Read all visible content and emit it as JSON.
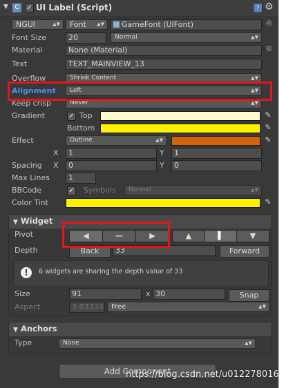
{
  "header": {
    "title": "UI Label (Script)",
    "icons": [
      "foldout-triangle",
      "script-icon",
      "enabled-checkbox",
      "book-icon",
      "gear-icon"
    ]
  },
  "font_row": {
    "type_value": "NGUI",
    "font_value": "Font",
    "font_asset": "GameFont (UIFont)"
  },
  "font_size": {
    "label": "Font Size",
    "value": "20",
    "style": "Normal"
  },
  "material": {
    "label": "Material",
    "value": "None (Material)"
  },
  "text": {
    "label": "Text",
    "value": "TEXT_MAINVIEW_13"
  },
  "overflow": {
    "label": "Overflow",
    "value": "Shrink Content"
  },
  "alignment": {
    "label": "Alignment",
    "value": "Left",
    "label_color": "#4c8cf0"
  },
  "keep_crisp": {
    "label": "Keep crisp",
    "value": "Never"
  },
  "gradient": {
    "label": "Gradient",
    "top_label": "Top",
    "top_color": "#fffdd0",
    "bottom_label": "Bottom",
    "bottom_color": "#fff200"
  },
  "effect": {
    "label": "Effect",
    "value": "Outline",
    "color": "#d26410",
    "x_label": "X",
    "x_value": "1",
    "y_label": "Y",
    "y_value": "1"
  },
  "spacing": {
    "label": "Spacing",
    "x_label": "X",
    "x_value": "0",
    "y_label": "Y",
    "y_value": "0"
  },
  "max_lines": {
    "label": "Max Lines",
    "value": "1"
  },
  "bbcode": {
    "label": "BBCode",
    "symbols_label": "Symbols",
    "symbols_value": "Normal"
  },
  "color_tint": {
    "label": "Color Tint",
    "color": "#fff200"
  },
  "widget": {
    "title": "Widget",
    "pivot_label": "Pivot",
    "pivot_buttons": [
      "◀",
      "—",
      "▶",
      "▲",
      "▌",
      "▼"
    ],
    "depth_label": "Depth",
    "back_label": "Back",
    "depth_value": "33",
    "forward_label": "Forward",
    "info_text": "6 widgets are sharing the depth value of 33",
    "size_label": "Size",
    "size_w": "91",
    "size_x": "x",
    "size_h": "30",
    "snap_label": "Snap",
    "aspect_label": "Aspect",
    "aspect_value": "3.03333",
    "aspect_mode": "Free"
  },
  "anchors": {
    "title": "Anchors",
    "type_label": "Type",
    "type_value": "None"
  },
  "add_component": "Add Component",
  "watermark": "https://blog.csdn.net/u012278016"
}
